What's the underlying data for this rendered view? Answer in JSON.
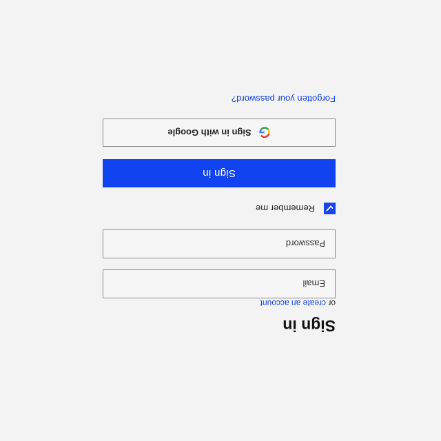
{
  "title": "Sign in",
  "subline": {
    "prefix": "or",
    "link": "create an account"
  },
  "fields": {
    "email_placeholder": "Email",
    "password_placeholder": "Password"
  },
  "remember": {
    "label": "Remember me",
    "checked": true
  },
  "buttons": {
    "sign_in": "Sign in",
    "google": "Sign in with Google"
  },
  "forgot_link": "Forgotten your password?",
  "icons": {
    "checkbox": "checkmark-icon",
    "google": "google-logo-icon"
  },
  "colors": {
    "accent": "#1243f0",
    "link": "#0f3fe8",
    "background": "#f3f3f3"
  },
  "page_orientation": "rotated 180 degrees"
}
